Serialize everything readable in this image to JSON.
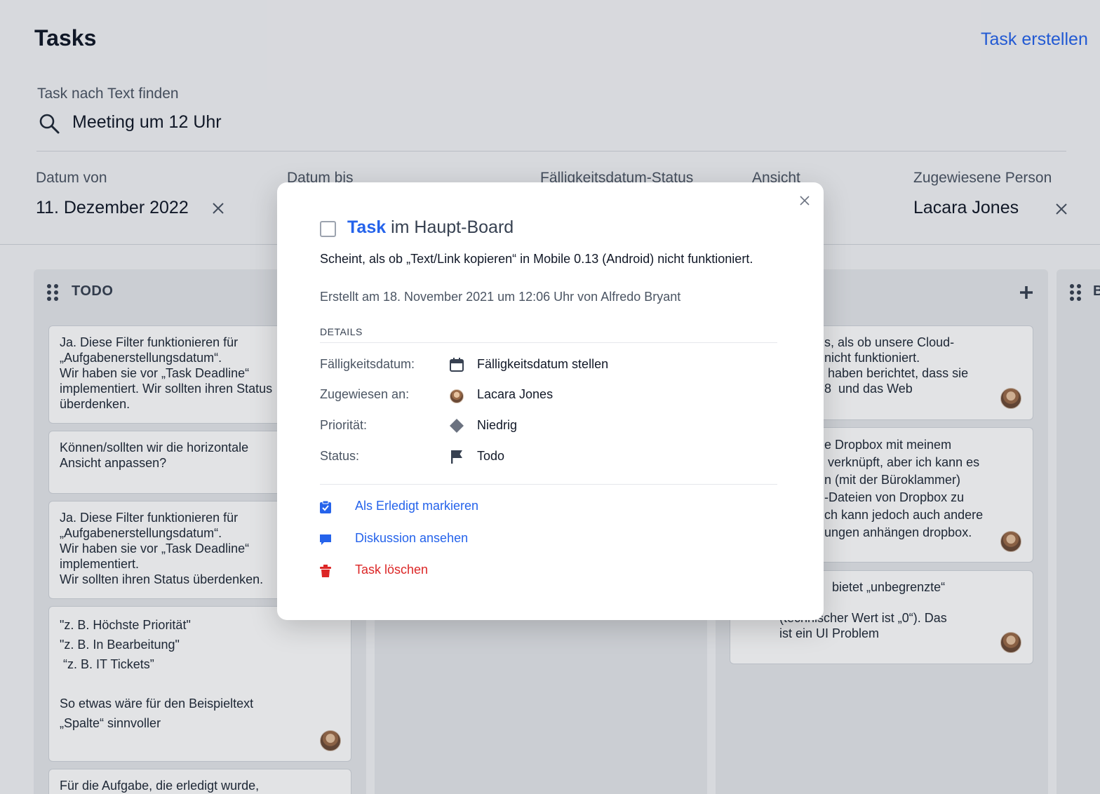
{
  "header": {
    "title": "Tasks",
    "create_label": "Task erstellen"
  },
  "search": {
    "label": "Task nach Text finden",
    "value": "Meeting um 12 Uhr"
  },
  "filters": [
    {
      "label": "Datum von",
      "value": "11. Dezember 2022"
    },
    {
      "label": "Datum bis"
    },
    {
      "label": "Fälligkeitsdatum-Status"
    },
    {
      "label": "Ansicht"
    },
    {
      "label": "Zugewiesene Person",
      "value": "Lacara Jones"
    }
  ],
  "board": {
    "columns": [
      {
        "title": "TODO",
        "cards": [
          {
            "text": "Ja. Diese Filter funktionieren für\n„Aufgabenerstellungsdatum“.\nWir haben sie vor „Task Deadline“\nimplementiert. Wir sollten ihren Status\nüberdenken."
          },
          {
            "text": "Können/sollten wir die horizontale\nAnsicht anpassen?"
          },
          {
            "text": "Ja. Diese Filter funktionieren für\n„Aufgabenerstellungsdatum“.\nWir haben sie vor „Task Deadline“\nimplementiert.\nWir sollten ihren Status überdenken."
          },
          {
            "lines": [
              "\"z. B. Höchste Priorität\"",
              "\"z. B. In Bearbeitung\"",
              " “z. B. IT Tickets”",
              "",
              "So etwas wäre für den Beispieltext",
              "„Spalte“ sinnvoller"
            ]
          },
          {
            "text": "Für die Aufgabe, die erledigt wurde,"
          }
        ]
      },
      {
        "cards": [
          {
            "text": "s, als ob unsere Cloud-\nnicht funktioniert.\n haben berichtet, dass sie\n8  und das Web"
          },
          {
            "text": "e Dropbox mit meinem\n verknüpft, aber ich kann es\nn (mit der Büroklammer)\n-Dateien von Dropbox zu\nch kann jedoch auch andere\nungen anhängen dropbox."
          },
          {
            "text": " bietet „unbegrenzte“"
          },
          {
            "text": "(technischer Wert ist „0“). Das\nist ein UI Problem"
          }
        ]
      },
      {
        "title": "B"
      }
    ]
  },
  "modal": {
    "title_task": "Task",
    "title_rest": "im Haupt-Board",
    "description": "Scheint, als ob „Text/Link kopieren“ in Mobile 0.13 (Android) nicht funktioniert.",
    "meta": "Erstellt am 18. November 2021 um 12:06 Uhr von Alfredo Bryant",
    "details_heading": "DETAILS",
    "details": [
      {
        "key": "Fälligkeitsdatum:",
        "value": "Fälligkeitsdatum stellen",
        "icon": "calendar-icon"
      },
      {
        "key": "Zugewiesen an:",
        "value": "Lacara Jones",
        "icon": "avatar"
      },
      {
        "key": "Priorität:",
        "value": "Niedrig",
        "icon": "diamond-icon",
        "color": "#6b7280"
      },
      {
        "key": "Status:",
        "value": "Todo",
        "icon": "flag-icon"
      }
    ],
    "actions": [
      {
        "label": "Als Erledigt markieren",
        "icon": "check-square-icon",
        "color": "#2563eb"
      },
      {
        "label": "Diskussion ansehen",
        "icon": "chat-icon",
        "color": "#2563eb"
      },
      {
        "label": "Task löschen",
        "icon": "trash-icon",
        "color": "#dc2626"
      }
    ]
  },
  "colors": {
    "accent": "#2563eb",
    "danger": "#dc2626",
    "background": "#f3f4f6"
  }
}
